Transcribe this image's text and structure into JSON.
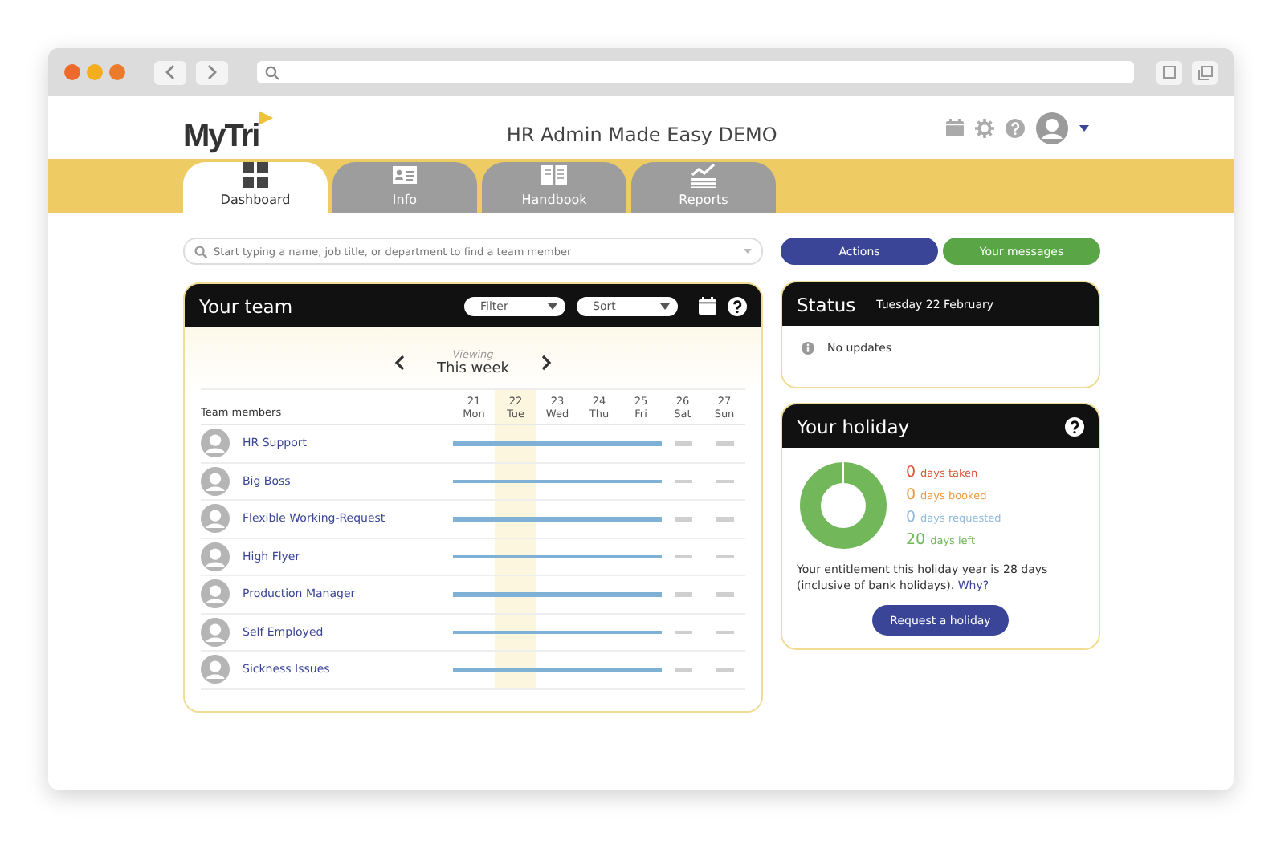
{
  "app": {
    "logo": "MyTri",
    "title": "HR Admin Made Easy DEMO"
  },
  "tabs": [
    {
      "label": "Dashboard",
      "selected": true
    },
    {
      "label": "Info",
      "selected": false
    },
    {
      "label": "Handbook",
      "selected": false
    },
    {
      "label": "Reports",
      "selected": false
    }
  ],
  "search": {
    "placeholder": "Start typing a name, job title, or department to find a team member"
  },
  "buttons": [
    {
      "label": "Actions",
      "color": "#3b4597"
    },
    {
      "label": "Your messages",
      "color": "#5aa646"
    }
  ],
  "team": {
    "title": "Your team",
    "filter": "Filter",
    "sort": "Sort",
    "viewing_label": "Viewing",
    "viewing": "This week",
    "members_heading": "Team members",
    "days": [
      {
        "date": "21",
        "day": "Mon",
        "kind": "weekday",
        "selected": false
      },
      {
        "date": "22",
        "day": "Tue",
        "kind": "weekday",
        "selected": true
      },
      {
        "date": "23",
        "day": "Wed",
        "kind": "weekday",
        "selected": false
      },
      {
        "date": "24",
        "day": "Thu",
        "kind": "weekday",
        "selected": false
      },
      {
        "date": "25",
        "day": "Fri",
        "kind": "weekday",
        "selected": false
      },
      {
        "date": "26",
        "day": "Sat",
        "kind": "weekend",
        "selected": false
      },
      {
        "date": "27",
        "day": "Sun",
        "kind": "weekend",
        "selected": false
      }
    ],
    "members": [
      "HR Support",
      "Big Boss",
      "Flexible Working-Request",
      "High Flyer",
      "Production Manager",
      "Self Employed",
      "Sickness Issues"
    ]
  },
  "status": {
    "title": "Status",
    "date": "Tuesday 22 February",
    "message": "No updates"
  },
  "holiday": {
    "title": "Your holiday",
    "stats": [
      {
        "count": "0",
        "label": "days taken",
        "color": "#d9573a"
      },
      {
        "count": "0",
        "label": "days booked",
        "color": "#eb9a45"
      },
      {
        "count": "0",
        "label": "days requested",
        "color": "#8fb9dd"
      },
      {
        "count": "20",
        "label": "days left",
        "color": "#72b85a"
      }
    ],
    "entitlement": "Your entitlement this holiday year is 28 days (inclusive of bank holidays).",
    "why": "Why?",
    "request": "Request a holiday"
  }
}
